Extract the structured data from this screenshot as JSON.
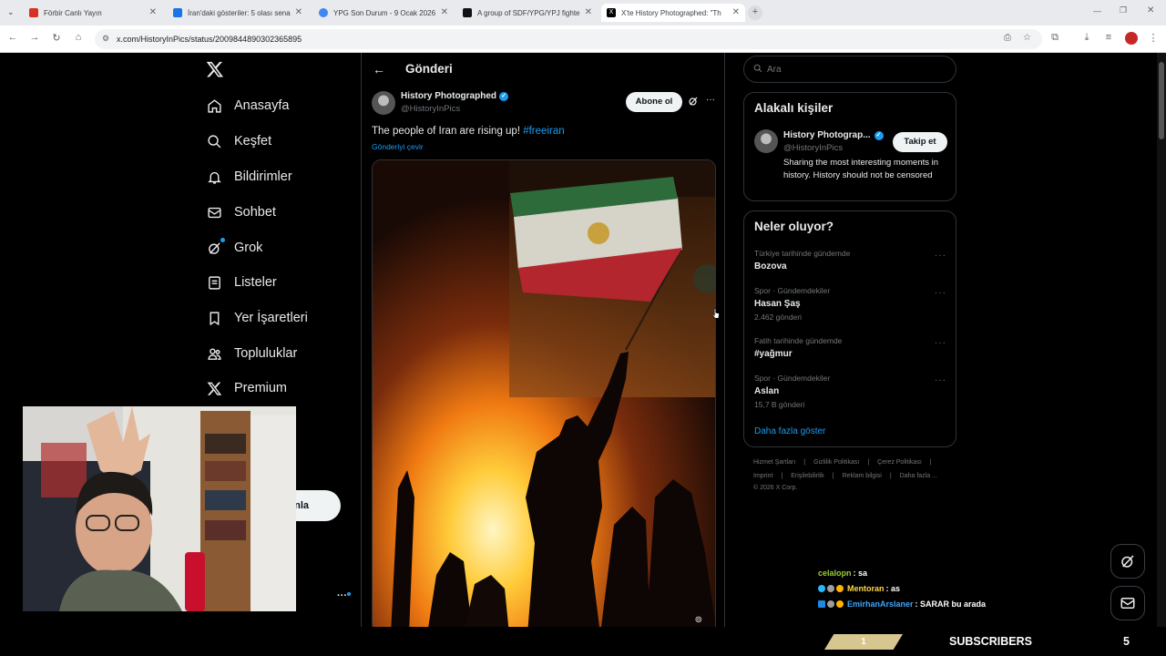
{
  "browser": {
    "tabs": [
      {
        "title": "Förbir Canlı Yayın",
        "icon_color": "#d93025"
      },
      {
        "title": "İran'daki gösteriler: 5 olası sena",
        "icon_color": "#1a73e8"
      },
      {
        "title": "YPG Son Durum - 9 Ocak 2026",
        "icon_color": "#4285f4"
      },
      {
        "title": "A group of SDF/YPG/YPJ fighte",
        "icon_color": "#111111"
      },
      {
        "title": "X'te History Photographed: \"Th",
        "icon_color": "#000000"
      }
    ],
    "url": "x.com/HistoryInPics/status/2009844890302365895"
  },
  "x": {
    "logo": "X",
    "nav": [
      {
        "label": "Anasayfa",
        "icon": "home-icon"
      },
      {
        "label": "Keşfet",
        "icon": "search-icon"
      },
      {
        "label": "Bildirimler",
        "icon": "bell-icon"
      },
      {
        "label": "Sohbet",
        "icon": "mail-icon"
      },
      {
        "label": "Grok",
        "icon": "grok-icon"
      },
      {
        "label": "Listeler",
        "icon": "list-icon"
      },
      {
        "label": "Yer İşaretleri",
        "icon": "bookmark-icon"
      },
      {
        "label": "Topluluklar",
        "icon": "people-icon"
      },
      {
        "label": "Premium",
        "icon": "x-premium-icon"
      }
    ],
    "post_button_partial": "nla",
    "more_dots": "···"
  },
  "post": {
    "header_title": "Gönderi",
    "author_name": "History Photographed",
    "author_handle": "@HistoryInPics",
    "subscribe_label": "Abone ol",
    "text": "The people of Iran are rising up! ",
    "hashtag": "#freeiran",
    "translate_label": "Gönderiyi çevir"
  },
  "sidebar": {
    "search_placeholder": "Ara",
    "related_title": "Alakalı kişiler",
    "related_name": "History Photograp...",
    "related_handle": "@HistoryInPics",
    "follow_label": "Takip et",
    "related_bio": "Sharing the most interesting moments in history. History should not be censored",
    "trends_title": "Neler oluyor?",
    "trends": [
      {
        "meta": "Türkiye tarihinde gündemde",
        "title": "Bozova",
        "count": ""
      },
      {
        "meta": "Spor · Gündemdekiler",
        "title": "Hasan Şaş",
        "count": "2.462 gönderi"
      },
      {
        "meta": "Fatih tarihinde gündemde",
        "title": "#yağmur",
        "count": ""
      },
      {
        "meta": "Spor · Gündemdekiler",
        "title": "Aslan",
        "count": "15,7 B gönderi"
      }
    ],
    "show_more": "Daha fazla göster",
    "footer_row1": [
      "Hizmet Şartları",
      "Gizlilik Politikası",
      "Çerez Politikası"
    ],
    "footer_row2": [
      "Imprint",
      "Erişilebilirlik",
      "Reklam bilgisi",
      "Daha fazla ..."
    ],
    "copyright": "© 2026 X Corp."
  },
  "chat": [
    {
      "user": "celalopn",
      "message": ": sa",
      "user_color": "#9acd32"
    },
    {
      "user": "Mentoran",
      "message": ": as",
      "user_color": "#ffd54f"
    },
    {
      "user": "EmirhanArslaner",
      "message": ": SARAR bu arada",
      "user_color": "#42a5f5"
    }
  ],
  "stream_bar": {
    "rank": "1",
    "label": "SUBSCRIBERS",
    "count": "5"
  },
  "colors": {
    "accent": "#1d9bf0",
    "verified": "#1d9bf0",
    "background": "#000000"
  }
}
